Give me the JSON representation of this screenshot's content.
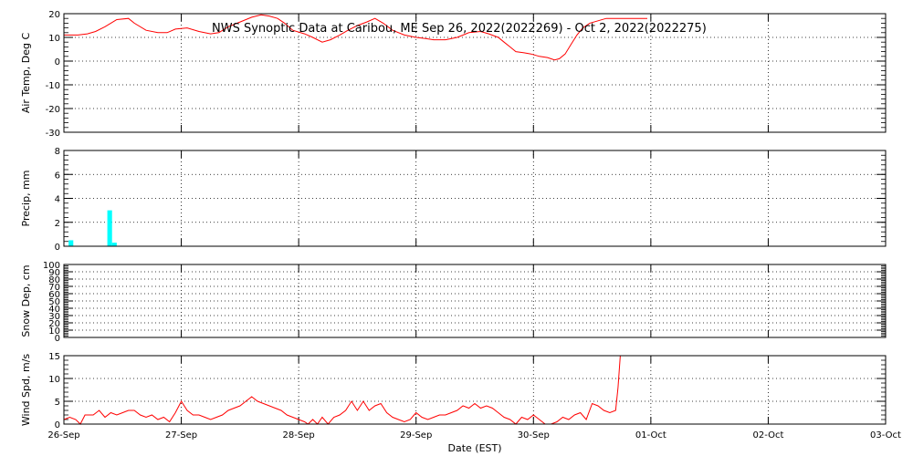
{
  "chart_data": {
    "type": "line",
    "title": "NWS Synoptic Data at Caribou, ME   Sep 26, 2022(2022269) - Oct  2, 2022(2022275)",
    "xlabel": "Date (EST)",
    "x_tick_labels": [
      "26-Sep",
      "27-Sep",
      "28-Sep",
      "29-Sep",
      "30-Sep",
      "01-Oct",
      "02-Oct",
      "03-Oct"
    ],
    "x_range_days": [
      0,
      7
    ],
    "grid": true,
    "colors": {
      "line": "#ff0000",
      "bar": "#00ffff",
      "axes": "#000000",
      "grid": "#000000"
    },
    "panels": [
      {
        "id": "air-temp",
        "type": "line",
        "ylabel": "Air Temp, Deg C",
        "ylim": [
          -30,
          20
        ],
        "yticks": [
          -30,
          -20,
          -10,
          0,
          10,
          20
        ],
        "series": [
          {
            "points": [
              [
                0.0,
                11
              ],
              [
                0.12,
                11
              ],
              [
                0.2,
                11.5
              ],
              [
                0.27,
                12.5
              ],
              [
                0.35,
                14.5
              ],
              [
                0.45,
                17.5
              ],
              [
                0.55,
                18
              ],
              [
                0.6,
                16
              ],
              [
                0.7,
                13
              ],
              [
                0.8,
                12
              ],
              [
                0.88,
                12
              ],
              [
                0.95,
                13.5
              ],
              [
                1.05,
                14
              ],
              [
                1.15,
                12.5
              ],
              [
                1.25,
                11.5
              ],
              [
                1.32,
                12
              ],
              [
                1.4,
                14.5
              ],
              [
                1.5,
                16.5
              ],
              [
                1.6,
                18.5
              ],
              [
                1.68,
                19.5
              ],
              [
                1.75,
                19
              ],
              [
                1.82,
                18
              ],
              [
                1.88,
                16
              ],
              [
                1.95,
                13
              ],
              [
                2.05,
                11.5
              ],
              [
                2.12,
                10
              ],
              [
                2.2,
                8
              ],
              [
                2.27,
                9
              ],
              [
                2.35,
                11
              ],
              [
                2.42,
                13
              ],
              [
                2.5,
                15
              ],
              [
                2.58,
                16.5
              ],
              [
                2.65,
                18
              ],
              [
                2.72,
                16
              ],
              [
                2.8,
                13
              ],
              [
                2.9,
                11
              ],
              [
                3.0,
                10
              ],
              [
                3.08,
                9.5
              ],
              [
                3.15,
                9
              ],
              [
                3.25,
                9
              ],
              [
                3.35,
                10
              ],
              [
                3.45,
                12
              ],
              [
                3.55,
                12.5
              ],
              [
                3.62,
                11.5
              ],
              [
                3.7,
                10
              ],
              [
                3.75,
                8
              ],
              [
                3.8,
                6
              ],
              [
                3.85,
                4
              ],
              [
                3.92,
                3.5
              ],
              [
                3.98,
                3
              ],
              [
                4.05,
                2
              ],
              [
                4.12,
                1.5
              ],
              [
                4.18,
                0.5
              ],
              [
                4.22,
                1
              ],
              [
                4.27,
                3
              ],
              [
                4.32,
                7
              ],
              [
                4.37,
                11
              ],
              [
                4.42,
                14
              ],
              [
                4.48,
                16
              ],
              [
                4.55,
                17
              ],
              [
                4.62,
                18
              ],
              [
                4.7,
                18
              ],
              [
                4.8,
                18
              ],
              [
                4.9,
                18
              ],
              [
                4.97,
                18
              ]
            ]
          }
        ]
      },
      {
        "id": "precip",
        "type": "bar",
        "ylabel": "Precip, mm",
        "ylim": [
          0,
          8
        ],
        "yticks": [
          0,
          2,
          4,
          6,
          8
        ],
        "bars": [
          {
            "day": 0.04,
            "width_days": 0.04,
            "value": 0.5
          },
          {
            "day": 0.37,
            "width_days": 0.04,
            "value": 3.0
          },
          {
            "day": 0.41,
            "width_days": 0.04,
            "value": 0.3
          }
        ]
      },
      {
        "id": "snow-depth",
        "type": "line",
        "ylabel": "Snow Dep, cm",
        "ylim": [
          0,
          100
        ],
        "yticks": [
          0,
          10,
          20,
          30,
          40,
          50,
          60,
          70,
          80,
          90,
          100
        ],
        "series": []
      },
      {
        "id": "wind-speed",
        "type": "line",
        "ylabel": "Wind Spd, m/s",
        "ylim": [
          0,
          15
        ],
        "yticks": [
          0,
          5,
          10,
          15
        ],
        "series": [
          {
            "points": [
              [
                0.0,
                1
              ],
              [
                0.05,
                1.5
              ],
              [
                0.1,
                1
              ],
              [
                0.14,
                0
              ],
              [
                0.18,
                2
              ],
              [
                0.25,
                2
              ],
              [
                0.3,
                3
              ],
              [
                0.35,
                1.5
              ],
              [
                0.4,
                2.5
              ],
              [
                0.45,
                2
              ],
              [
                0.5,
                2.5
              ],
              [
                0.55,
                3
              ],
              [
                0.6,
                3
              ],
              [
                0.65,
                2
              ],
              [
                0.7,
                1.5
              ],
              [
                0.75,
                2
              ],
              [
                0.8,
                1
              ],
              [
                0.85,
                1.5
              ],
              [
                0.9,
                0.5
              ],
              [
                0.95,
                2.5
              ],
              [
                1.0,
                5
              ],
              [
                1.05,
                3
              ],
              [
                1.1,
                2
              ],
              [
                1.15,
                2
              ],
              [
                1.2,
                1.5
              ],
              [
                1.25,
                1
              ],
              [
                1.3,
                1.5
              ],
              [
                1.35,
                2
              ],
              [
                1.4,
                3
              ],
              [
                1.45,
                3.5
              ],
              [
                1.5,
                4
              ],
              [
                1.55,
                5
              ],
              [
                1.6,
                6
              ],
              [
                1.65,
                5
              ],
              [
                1.7,
                4.5
              ],
              [
                1.75,
                4
              ],
              [
                1.8,
                3.5
              ],
              [
                1.85,
                3
              ],
              [
                1.9,
                2
              ],
              [
                1.95,
                1.5
              ],
              [
                2.0,
                1
              ],
              [
                2.05,
                0.5
              ],
              [
                2.08,
                0
              ],
              [
                2.12,
                1
              ],
              [
                2.16,
                0
              ],
              [
                2.2,
                1.5
              ],
              [
                2.25,
                0
              ],
              [
                2.3,
                1.5
              ],
              [
                2.35,
                2
              ],
              [
                2.4,
                3
              ],
              [
                2.45,
                5
              ],
              [
                2.5,
                3
              ],
              [
                2.55,
                5
              ],
              [
                2.6,
                3
              ],
              [
                2.65,
                4
              ],
              [
                2.7,
                4.5
              ],
              [
                2.75,
                2.5
              ],
              [
                2.8,
                1.5
              ],
              [
                2.85,
                1
              ],
              [
                2.9,
                0.5
              ],
              [
                2.95,
                1
              ],
              [
                3.0,
                2.5
              ],
              [
                3.05,
                1.5
              ],
              [
                3.1,
                1
              ],
              [
                3.15,
                1.5
              ],
              [
                3.2,
                2
              ],
              [
                3.25,
                2
              ],
              [
                3.3,
                2.5
              ],
              [
                3.35,
                3
              ],
              [
                3.4,
                4
              ],
              [
                3.45,
                3.5
              ],
              [
                3.5,
                4.5
              ],
              [
                3.55,
                3.5
              ],
              [
                3.6,
                4
              ],
              [
                3.65,
                3.5
              ],
              [
                3.7,
                2.5
              ],
              [
                3.75,
                1.5
              ],
              [
                3.8,
                1
              ],
              [
                3.85,
                0
              ],
              [
                3.9,
                1.5
              ],
              [
                3.95,
                1
              ],
              [
                4.0,
                2
              ],
              [
                4.05,
                1
              ],
              [
                4.1,
                0
              ],
              [
                4.15,
                0
              ],
              [
                4.2,
                0.5
              ],
              [
                4.25,
                1.5
              ],
              [
                4.3,
                1
              ],
              [
                4.35,
                2
              ],
              [
                4.4,
                2.5
              ],
              [
                4.45,
                1
              ],
              [
                4.5,
                4.5
              ],
              [
                4.55,
                4
              ],
              [
                4.6,
                3
              ],
              [
                4.65,
                2.5
              ],
              [
                4.7,
                3
              ],
              [
                4.72,
                8
              ],
              [
                4.74,
                15
              ]
            ]
          }
        ]
      }
    ]
  }
}
